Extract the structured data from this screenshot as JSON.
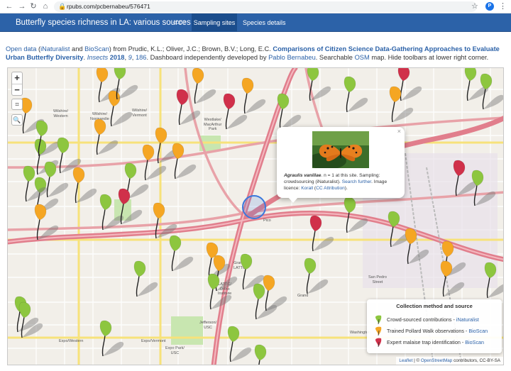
{
  "browser": {
    "url": "rpubs.com/pcbernabeu/576471",
    "avatar_letter": "P"
  },
  "navbar": {
    "title": "Butterfly species richness in LA: various sources",
    "tab_code": "code",
    "tab_sampling": "Sampling sites",
    "tab_species": "Species details"
  },
  "description": {
    "open_data": "Open data",
    "paren_open": " (",
    "inaturalist": "iNaturalist",
    "and": " and ",
    "bioscan": "BioScan",
    "from": ") from Prudic, K.L.; Oliver, J.C.; Brown, B.V.; Long, E.C. ",
    "paper_title": "Comparisons of Citizen Science Data-Gathering Approaches to Evaluate Urban Butterfly Diversity",
    "period": ". ",
    "journal": "Insects",
    "year": "2018",
    "volume": "9",
    "pages": "186",
    "dash": ". Dashboard independently developed by ",
    "author_link": "Pablo Bernabeu",
    "searchable": ". Searchable ",
    "osm": "OSM",
    "rest": " map. Hide toolbars at lower right corner."
  },
  "map": {
    "zoom_in": "+",
    "zoom_out": "−",
    "fullscreen": "⌗",
    "search": "🔍",
    "labels": {
      "wilshire_western": "Wilshire/\nWestern",
      "wilshire_normandie": "Wilshire/\nNormandie",
      "wilshire_vermont": "Wilshire/\nVermont",
      "westlake": "Westlake/\nMacArthur\nPark",
      "pico": "Pico",
      "grand_lattc": "Grand/\nLATTC",
      "lattc": "LATTC/\nOrtho\nInstitute",
      "jefferson": "Jefferson/\nUSC",
      "expo_western": "Expo/Western",
      "expo_vermont": "Expo/Vermont",
      "expo_park": "Expo Park/\nUSC",
      "washington": "Washington",
      "san_pedro": "San Pedro\nStreet",
      "grand": "Grand"
    }
  },
  "popup": {
    "close": "×",
    "species": "Agraulis vanillae",
    "n_text": ". n = 1 at this site. Sampling: crowdsourcing (iNaturalist). ",
    "search_further": "Search further",
    "licence_text": ". Image licence: ",
    "korall": "Korall",
    "cc_paren_open": " (",
    "cc_attr": "CC Attribution",
    "cc_paren_close": ")."
  },
  "legend": {
    "title": "Collection method and source",
    "row1_prefix": "Crowd-sourced contributions - ",
    "row1_link": "iNaturalist",
    "row2_prefix": "Trained Pollard Walk observations - ",
    "row2_link": "BioScan",
    "row3_prefix": "Expert malaise trap identification - ",
    "row3_link": "BioScan",
    "colors": {
      "green": "#8dc63f",
      "orange": "#f5a623",
      "red": "#d0304a"
    }
  },
  "attribution": {
    "leaflet": "Leaflet",
    "sep": " | © ",
    "osm": "OpenStreetMap",
    "rest": " contributors, CC-BY-SA"
  }
}
